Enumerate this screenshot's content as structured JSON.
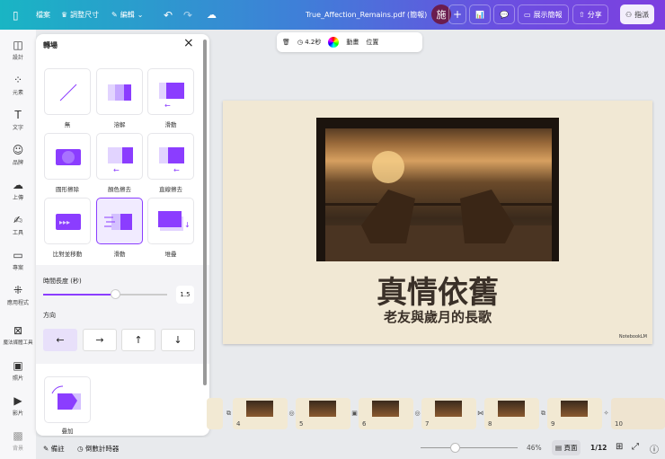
{
  "topbar": {
    "file": "檔案",
    "resize": "調整尺寸",
    "edit": "編輯",
    "doc_title": "True_Affection_Remains.pdf (簡報)",
    "avatar": "施",
    "present": "展示簡報",
    "share": "分享",
    "assign": "指派"
  },
  "float_toolbar": {
    "duration": "4.2秒",
    "animate": "動畫",
    "position": "位置"
  },
  "rail": [
    "設計",
    "元素",
    "文字",
    "品牌",
    "上傳",
    "工具",
    "專案",
    "應用程式",
    "魔法媒體工具",
    "照片",
    "影片",
    "背景"
  ],
  "panel": {
    "title": "轉場",
    "transitions": [
      "無",
      "溶解",
      "滑動",
      "圓形擦除",
      "顏色擦去",
      "直線擦去",
      "比對並移動",
      "滑動",
      "堆疊"
    ],
    "duration_label": "時間長度 (秒)",
    "duration_value": "1.5",
    "duration_fraction": 0.58,
    "direction_label": "方向",
    "directions": [
      "←",
      "→",
      "↑",
      "↓"
    ],
    "extra": [
      "疊加"
    ]
  },
  "slide": {
    "title": "真情依舊",
    "subtitle": "老友與歲月的長歌",
    "watermark": "NotebookLM"
  },
  "filmstrip": {
    "pages": [
      "4",
      "5",
      "6",
      "7",
      "8",
      "9",
      "10"
    ]
  },
  "bottom": {
    "notes": "備註",
    "timer": "倒數計時器",
    "zoom": "46%",
    "zoom_fraction": 0.35,
    "view": "頁面",
    "page": "1/12"
  }
}
